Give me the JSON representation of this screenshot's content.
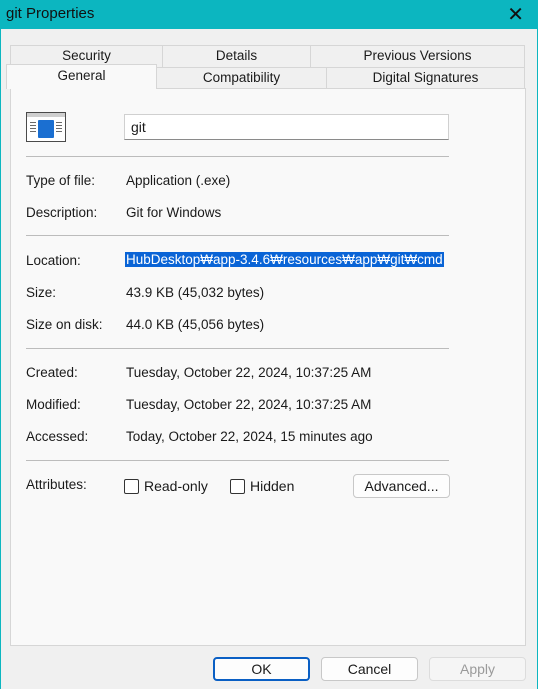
{
  "window": {
    "title": "git Properties"
  },
  "tabs": {
    "security": "Security",
    "details": "Details",
    "previous_versions": "Previous Versions",
    "general": "General",
    "compatibility": "Compatibility",
    "digital_signatures": "Digital Signatures"
  },
  "file_name": "git",
  "fields": {
    "type_label": "Type of file:",
    "type_value": "Application (.exe)",
    "description_label": "Description:",
    "description_value": "Git for Windows",
    "location_label": "Location:",
    "location_value": "HubDesktop₩app-3.4.6₩resources₩app₩git₩cmd",
    "size_label": "Size:",
    "size_value": "43.9 KB (45,032 bytes)",
    "size_on_disk_label": "Size on disk:",
    "size_on_disk_value": "44.0 KB (45,056 bytes)",
    "created_label": "Created:",
    "created_value": "Tuesday, October 22, 2024, 10:37:25 AM",
    "modified_label": "Modified:",
    "modified_value": "Tuesday, October 22, 2024, 10:37:25 AM",
    "accessed_label": "Accessed:",
    "accessed_value": "Today, October 22, 2024, 15 minutes ago",
    "attributes_label": "Attributes:"
  },
  "attributes": {
    "readonly_label": "Read-only",
    "readonly_checked": false,
    "hidden_label": "Hidden",
    "hidden_checked": false,
    "advanced_label": "Advanced..."
  },
  "buttons": {
    "ok": "OK",
    "cancel": "Cancel",
    "apply": "Apply"
  },
  "colors": {
    "titlebar": "#0cb6c0",
    "selection": "#0a64d6",
    "ok_border": "#0a5fc4"
  }
}
